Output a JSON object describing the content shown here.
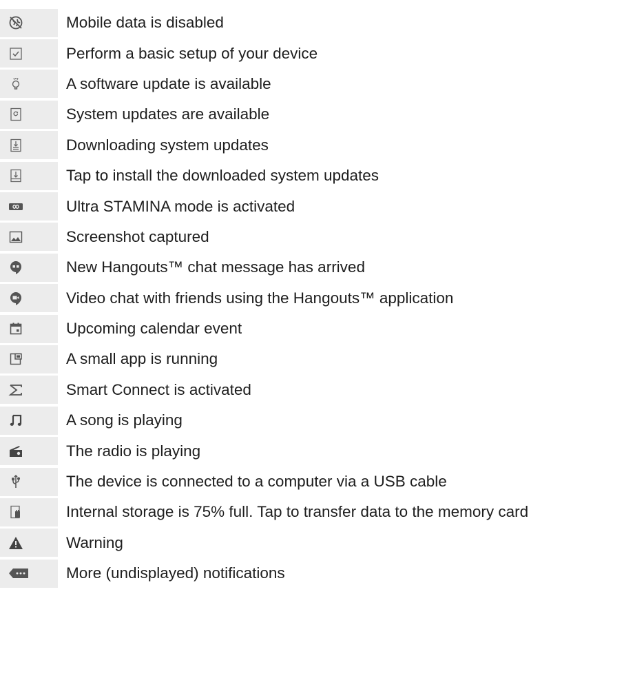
{
  "notifications": [
    {
      "icon": "mobile-data-disabled-icon",
      "text": "Mobile data is disabled"
    },
    {
      "icon": "checkbox-icon",
      "text": "Perform a basic setup of your device"
    },
    {
      "icon": "lightbulb-icon",
      "text": "A software update is available"
    },
    {
      "icon": "system-update-icon",
      "text": "System updates are available"
    },
    {
      "icon": "downloading-update-icon",
      "text": "Downloading system updates"
    },
    {
      "icon": "install-update-icon",
      "text": "Tap to install the downloaded system updates"
    },
    {
      "icon": "ultra-stamina-icon",
      "text": "Ultra STAMINA mode is activated"
    },
    {
      "icon": "screenshot-icon",
      "text": "Screenshot captured"
    },
    {
      "icon": "hangouts-message-icon",
      "text": "New Hangouts™ chat message has arrived"
    },
    {
      "icon": "hangouts-video-icon",
      "text": "Video chat with friends using the Hangouts™ application"
    },
    {
      "icon": "calendar-icon",
      "text": "Upcoming calendar event"
    },
    {
      "icon": "small-app-icon",
      "text": "A small app is running"
    },
    {
      "icon": "smart-connect-icon",
      "text": "Smart Connect is activated"
    },
    {
      "icon": "music-note-icon",
      "text": "A song is playing"
    },
    {
      "icon": "radio-icon",
      "text": "The radio is playing"
    },
    {
      "icon": "usb-icon",
      "text": "The device is connected to a computer via a USB cable"
    },
    {
      "icon": "storage-icon",
      "text": "Internal storage is 75% full. Tap to transfer data to the memory card"
    },
    {
      "icon": "warning-icon",
      "text": "Warning"
    },
    {
      "icon": "more-notifications-icon",
      "text": "More (undisplayed) notifications"
    }
  ],
  "colors": {
    "icon_background": "#ececec",
    "icon_stroke": "#555555",
    "text": "#1e1e1e"
  }
}
